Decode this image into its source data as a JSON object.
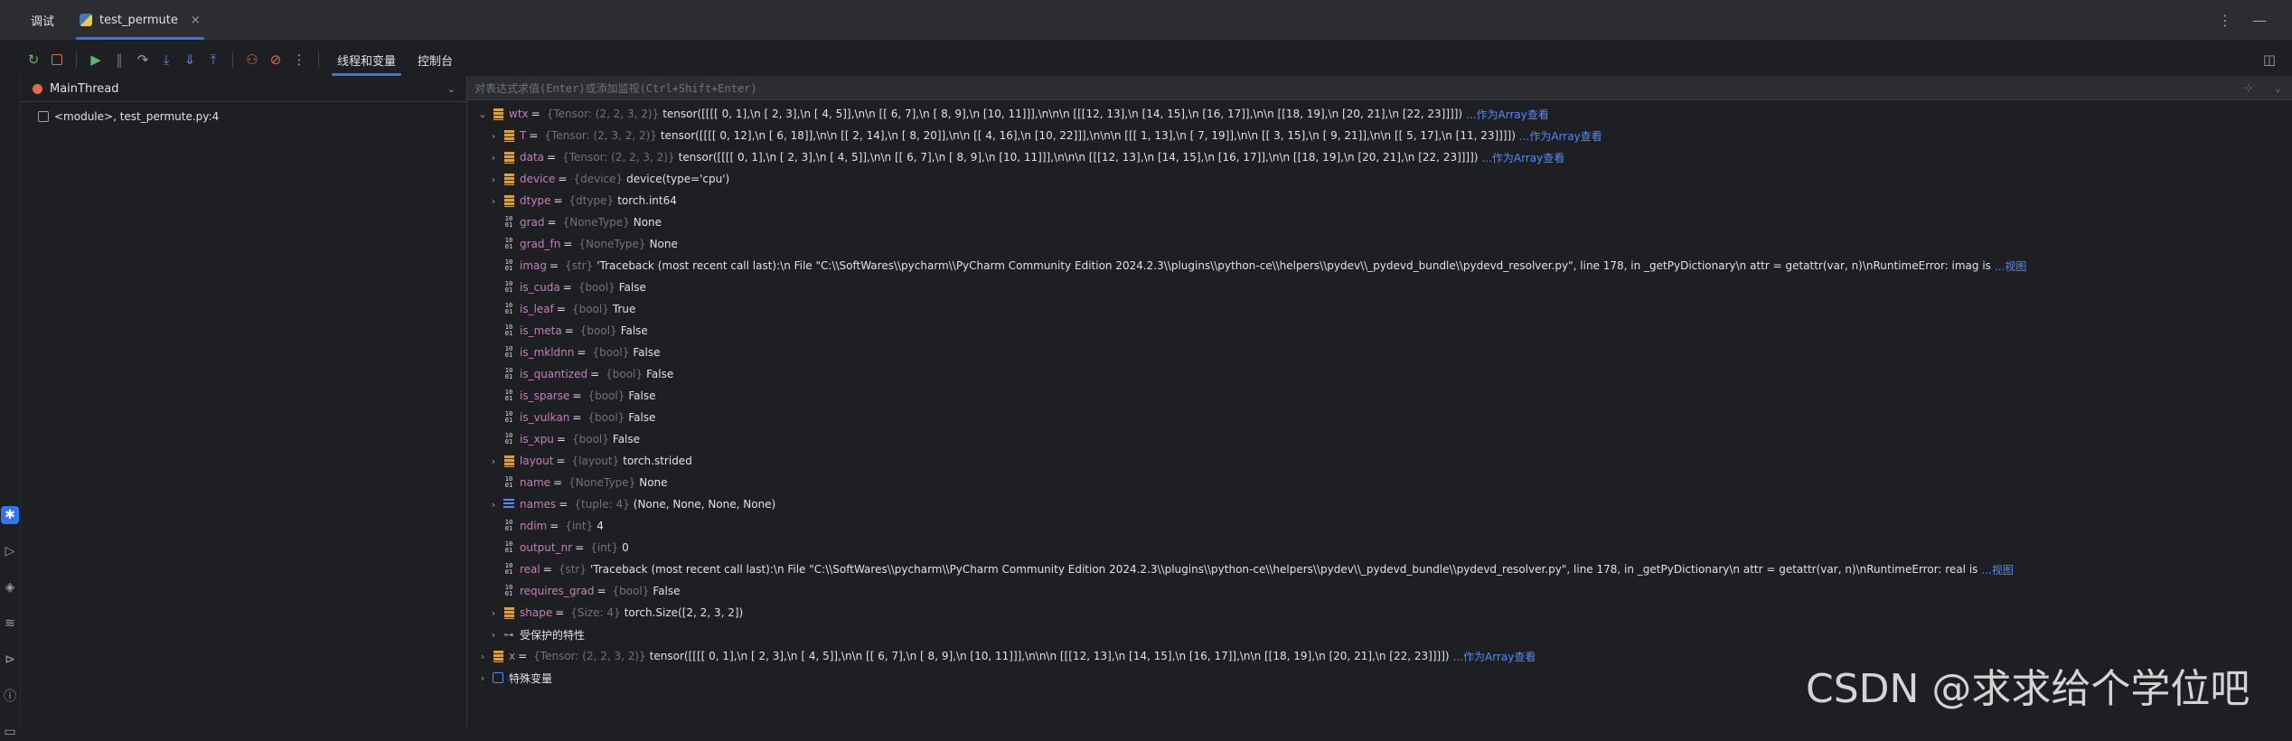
{
  "tabs": {
    "debug_label": "调试",
    "file_label": "test_permute",
    "close_symbol": "×",
    "more_symbol": "⋮",
    "minimize_symbol": "—"
  },
  "toolbar": {
    "tab_threads_vars": "线程和变量",
    "tab_console": "控制台"
  },
  "frames": {
    "thread_name": "MainThread",
    "frame_label": "<module>, test_permute.py:4"
  },
  "evaluate": {
    "placeholder": "对表达式求值(Enter)或添加监视(Ctrl+Shift+Enter)"
  },
  "variables": [
    {
      "indent": 0,
      "expanded": true,
      "icon": "tensor",
      "name": "wtx",
      "type": "{Tensor: (2, 2, 3, 2)}",
      "value": "tensor([[[[ 0,  1],\\n          [ 2,  3],\\n          [ 4,  5]],\\n\\n         [[ 6,  7],\\n          [ 8,  9],\\n          [10, 11]]],\\n\\n\\n        [[[12, 13],\\n          [14, 15],\\n          [16, 17]],\\n\\n         [[18, 19],\\n          [20, 21],\\n          [22, 23]]]])",
      "link": "...作为Array查看"
    },
    {
      "indent": 1,
      "expanded": false,
      "icon": "tensor",
      "name": "T",
      "type": "{Tensor: (2, 3, 2, 2)}",
      "value": "tensor([[[[ 0, 12],\\n          [ 6, 18]],\\n\\n         [[ 2, 14],\\n          [ 8, 20]],\\n\\n         [[ 4, 16],\\n          [10, 22]]],\\n\\n\\n        [[[ 1, 13],\\n          [ 7, 19]],\\n\\n         [[ 3, 15],\\n          [ 9, 21]],\\n\\n         [[ 5, 17],\\n          [11, 23]]]])",
      "link": "...作为Array查看"
    },
    {
      "indent": 1,
      "expanded": false,
      "icon": "tensor",
      "name": "data",
      "type": "{Tensor: (2, 2, 3, 2)}",
      "value": "tensor([[[[ 0,  1],\\n          [ 2,  3],\\n          [ 4,  5]],\\n\\n         [[ 6,  7],\\n          [ 8,  9],\\n          [10, 11]]],\\n\\n\\n        [[[12, 13],\\n          [14, 15],\\n          [16, 17]],\\n\\n         [[18, 19],\\n          [20, 21],\\n          [22, 23]]]])",
      "link": "...作为Array查看"
    },
    {
      "indent": 1,
      "expanded": false,
      "icon": "tensor",
      "name": "device",
      "type": "{device}",
      "value": "device(type='cpu')",
      "link": ""
    },
    {
      "indent": 1,
      "expanded": false,
      "icon": "tensor",
      "name": "dtype",
      "type": "{dtype}",
      "value": "torch.int64",
      "link": ""
    },
    {
      "indent": 1,
      "expanded": null,
      "icon": "prim",
      "name": "grad",
      "type": "{NoneType}",
      "value": "None",
      "link": ""
    },
    {
      "indent": 1,
      "expanded": null,
      "icon": "prim",
      "name": "grad_fn",
      "type": "{NoneType}",
      "value": "None",
      "link": ""
    },
    {
      "indent": 1,
      "expanded": null,
      "icon": "prim",
      "name": "imag",
      "type": "{str}",
      "value": "'Traceback (most recent call last):\\n  File \"C:\\\\SoftWares\\\\pycharm\\\\PyCharm Community Edition 2024.2.3\\\\plugins\\\\python-ce\\\\helpers\\\\pydev\\\\_pydevd_bundle\\\\pydevd_resolver.py\", line 178, in _getPyDictionary\\n    attr = getattr(var, n)\\nRuntimeError: imag is",
      "link": "...视图"
    },
    {
      "indent": 1,
      "expanded": null,
      "icon": "prim",
      "name": "is_cuda",
      "type": "{bool}",
      "value": "False",
      "link": ""
    },
    {
      "indent": 1,
      "expanded": null,
      "icon": "prim",
      "name": "is_leaf",
      "type": "{bool}",
      "value": "True",
      "link": ""
    },
    {
      "indent": 1,
      "expanded": null,
      "icon": "prim",
      "name": "is_meta",
      "type": "{bool}",
      "value": "False",
      "link": ""
    },
    {
      "indent": 1,
      "expanded": null,
      "icon": "prim",
      "name": "is_mkldnn",
      "type": "{bool}",
      "value": "False",
      "link": ""
    },
    {
      "indent": 1,
      "expanded": null,
      "icon": "prim",
      "name": "is_quantized",
      "type": "{bool}",
      "value": "False",
      "link": ""
    },
    {
      "indent": 1,
      "expanded": null,
      "icon": "prim",
      "name": "is_sparse",
      "type": "{bool}",
      "value": "False",
      "link": ""
    },
    {
      "indent": 1,
      "expanded": null,
      "icon": "prim",
      "name": "is_vulkan",
      "type": "{bool}",
      "value": "False",
      "link": ""
    },
    {
      "indent": 1,
      "expanded": null,
      "icon": "prim",
      "name": "is_xpu",
      "type": "{bool}",
      "value": "False",
      "link": ""
    },
    {
      "indent": 1,
      "expanded": false,
      "icon": "tensor",
      "name": "layout",
      "type": "{layout}",
      "value": "torch.strided",
      "link": ""
    },
    {
      "indent": 1,
      "expanded": null,
      "icon": "prim",
      "name": "name",
      "type": "{NoneType}",
      "value": "None",
      "link": ""
    },
    {
      "indent": 1,
      "expanded": false,
      "icon": "list",
      "name": "names",
      "type": "{tuple: 4}",
      "value": "(None, None, None, None)",
      "link": ""
    },
    {
      "indent": 1,
      "expanded": null,
      "icon": "prim",
      "name": "ndim",
      "type": "{int}",
      "value": "4",
      "link": ""
    },
    {
      "indent": 1,
      "expanded": null,
      "icon": "prim",
      "name": "output_nr",
      "type": "{int}",
      "value": "0",
      "link": ""
    },
    {
      "indent": 1,
      "expanded": null,
      "icon": "prim",
      "name": "real",
      "type": "{str}",
      "value": "'Traceback (most recent call last):\\n  File \"C:\\\\SoftWares\\\\pycharm\\\\PyCharm Community Edition 2024.2.3\\\\plugins\\\\python-ce\\\\helpers\\\\pydev\\\\_pydevd_bundle\\\\pydevd_resolver.py\", line 178, in _getPyDictionary\\n    attr = getattr(var, n)\\nRuntimeError: real is",
      "link": "...视图"
    },
    {
      "indent": 1,
      "expanded": null,
      "icon": "prim",
      "name": "requires_grad",
      "type": "{bool}",
      "value": "False",
      "link": ""
    },
    {
      "indent": 1,
      "expanded": false,
      "icon": "tensor",
      "name": "shape",
      "type": "{Size: 4}",
      "value": "torch.Size([2, 2, 3, 2])",
      "link": ""
    },
    {
      "indent": 1,
      "expanded": false,
      "icon": "key",
      "name": "受保护的特性",
      "type": "",
      "value": "",
      "link": "",
      "plain": true
    },
    {
      "indent": 0,
      "expanded": false,
      "icon": "tensor",
      "name": "x",
      "type": "{Tensor: (2, 2, 3, 2)}",
      "value": "tensor([[[[ 0,  1],\\n          [ 2,  3],\\n          [ 4,  5]],\\n\\n         [[ 6,  7],\\n          [ 8,  9],\\n          [10, 11]]],\\n\\n\\n        [[[12, 13],\\n          [14, 15],\\n          [16, 17]],\\n\\n         [[18, 19],\\n          [20, 21],\\n          [22, 23]]]])",
      "link": "...作为Array查看"
    },
    {
      "indent": 0,
      "expanded": false,
      "icon": "group",
      "name": "特殊变量",
      "type": "",
      "value": "",
      "link": "",
      "plain": true
    }
  ],
  "watermark": "CSDN @求求给个学位吧",
  "colors": {
    "accent": "#3574f0",
    "var_name": "#c77dbb",
    "link": "#548af7",
    "stop_red": "#e06c4c"
  }
}
